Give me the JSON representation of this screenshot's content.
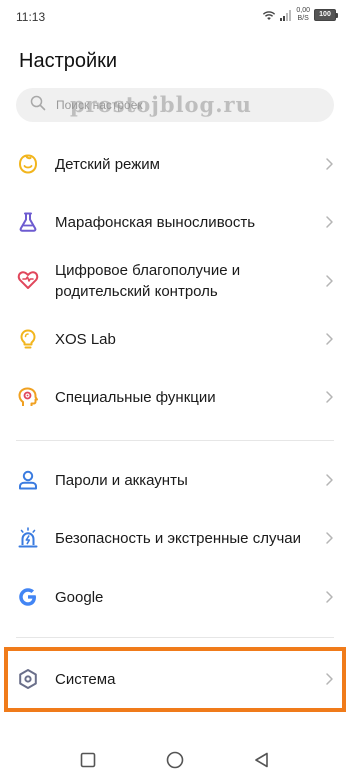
{
  "status_bar": {
    "time": "11:13",
    "net_speed_value": "0,00",
    "net_speed_unit": "B/S",
    "battery": "100"
  },
  "page": {
    "title": "Настройки"
  },
  "search": {
    "placeholder": "Поиск настроек"
  },
  "watermark": "prostojblog.ru",
  "settings": [
    {
      "id": "kids-mode",
      "label": "Детский режим",
      "icon": "kids-mode-icon",
      "color": "#f2b51d"
    },
    {
      "id": "marathon",
      "label": "Марафонская выносливость",
      "icon": "flask-icon",
      "color": "#6d5bd0"
    },
    {
      "id": "wellbeing",
      "label": "Цифровое благополучие и родительский контроль",
      "icon": "heart-icon",
      "color": "#e0475c"
    },
    {
      "id": "xos-lab",
      "label": "XOS Lab",
      "icon": "lightbulb-icon",
      "color": "#f2b51d"
    },
    {
      "id": "accessibility",
      "label": "Специальные функции",
      "icon": "accessibility-head-icon",
      "color": "#f0a020"
    },
    {
      "id": "passwords",
      "label": "Пароли и аккаунты",
      "icon": "account-icon",
      "color": "#3a7be0"
    },
    {
      "id": "safety",
      "label": "Безопасность и экстренные случаи",
      "icon": "emergency-icon",
      "color": "#3a7be0"
    },
    {
      "id": "google",
      "label": "Google",
      "icon": "google-icon",
      "color": "#4285f4"
    },
    {
      "id": "system",
      "label": "Система",
      "icon": "system-hexagon-icon",
      "color": "#6a6f8a"
    }
  ],
  "colors": {
    "highlight": "#f07b1a",
    "chevron": "#b5b5b5"
  }
}
